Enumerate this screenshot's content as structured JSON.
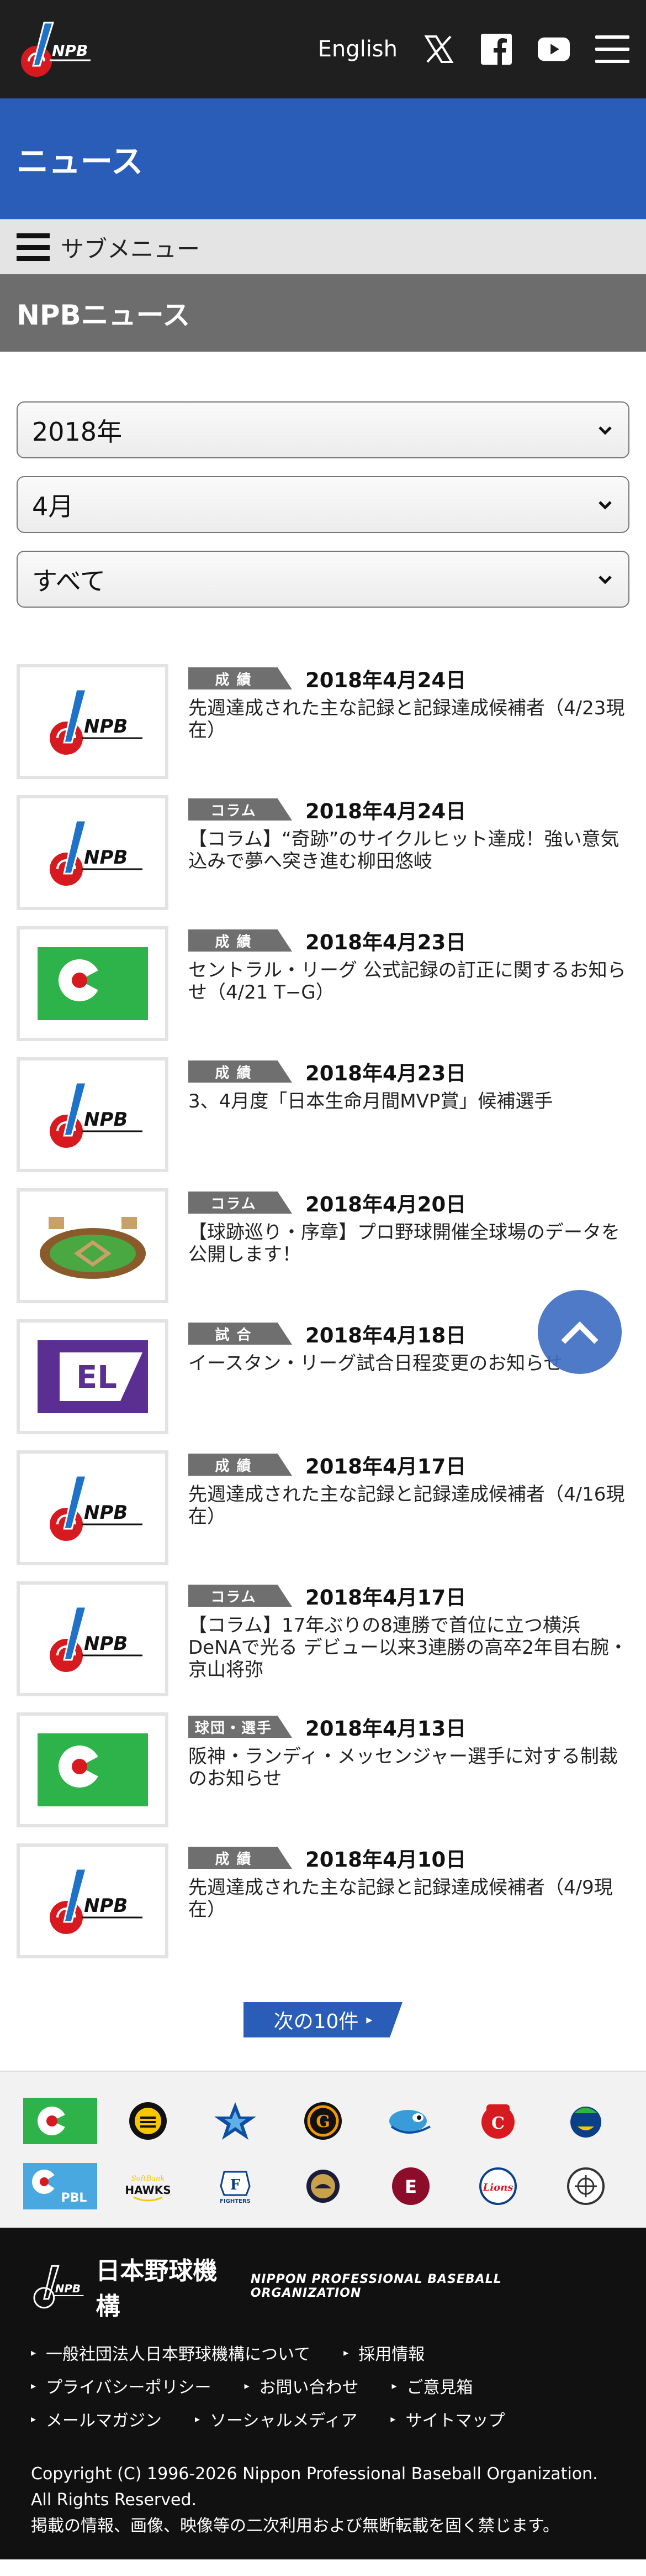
{
  "header": {
    "english_label": "English",
    "icons": [
      "x-icon",
      "facebook-icon",
      "youtube-icon",
      "menu-icon"
    ],
    "logo_text": "NPB"
  },
  "page": {
    "title": "ニュース",
    "submenu_label": "サブメニュー",
    "section_title": "NPBニュース"
  },
  "filters": {
    "year": "2018年",
    "month": "4月",
    "category": "すべて"
  },
  "colors": {
    "header_bg": "#1f1f1f",
    "brand_blue": "#2a5db8",
    "submenu_bg": "#e4e4e4",
    "section_bg": "#6d6d6d",
    "badge_bg": "#6f6f6f",
    "footer_bg": "#111111"
  },
  "news": [
    {
      "badge": "成 績",
      "date": "2018年4月24日",
      "headline": "先週達成された主な記録と記録達成候補者（4/23現在）",
      "thumb": "npb-logo-icon"
    },
    {
      "badge": "コラム",
      "date": "2018年4月24日",
      "headline": "【コラム】“奇跡”のサイクルヒット達成！強い意気込みで夢へ突き進む柳田悠岐",
      "thumb": "npb-logo-icon"
    },
    {
      "badge": "成 績",
      "date": "2018年4月23日",
      "headline": "セントラル・リーグ 公式記録の訂正に関するお知らせ（4/21 T−G）",
      "thumb": "central-league-icon"
    },
    {
      "badge": "成 績",
      "date": "2018年4月23日",
      "headline": "3、4月度「日本生命月間MVP賞」候補選手",
      "thumb": "npb-logo-icon"
    },
    {
      "badge": "コラム",
      "date": "2018年4月20日",
      "headline": "【球跡巡り・序章】プロ野球開催全球場のデータを公開します！",
      "thumb": "stadium-icon"
    },
    {
      "badge": "試 合",
      "date": "2018年4月18日",
      "headline": "イースタン・リーグ試合日程変更のお知らせ",
      "thumb": "eastern-league-icon"
    },
    {
      "badge": "成 績",
      "date": "2018年4月17日",
      "headline": "先週達成された主な記録と記録達成候補者（4/16現在）",
      "thumb": "npb-logo-icon"
    },
    {
      "badge": "コラム",
      "date": "2018年4月17日",
      "headline": "【コラム】17年ぶりの8連勝で首位に立つ横浜DeNAで光る デビュー以来3連勝の高卒2年目右腕・京山将弥",
      "thumb": "npb-logo-icon"
    },
    {
      "badge": "球団・選手",
      "date": "2018年4月13日",
      "headline": "阪神・ランディ・メッセンジャー選手に対する制裁のお知らせ",
      "thumb": "central-league-icon"
    },
    {
      "badge": "成 績",
      "date": "2018年4月10日",
      "headline": "先週達成された主な記録と記録達成候補者（4/9現在）",
      "thumb": "npb-logo-icon"
    }
  ],
  "next_button": "次の10件",
  "teams": {
    "row1": [
      "central-league-icon",
      "tigers-icon",
      "baystars-icon",
      "giants-icon",
      "swallows-icon",
      "carp-icon",
      "dragons-icon"
    ],
    "row2": [
      "pacific-league-icon",
      "hawks-icon",
      "fighters-icon",
      "buffaloes-icon",
      "eagles-icon",
      "lions-icon",
      "marines-icon"
    ]
  },
  "footer": {
    "org_jp": "日本野球機構",
    "org_en": "NIPPON PROFESSIONAL BASEBALL ORGANIZATION",
    "links_row1": [
      "一般社団法人日本野球機構について",
      "採用情報"
    ],
    "links_row2": [
      "プライバシーポリシー",
      "お問い合わせ",
      "ご意見箱"
    ],
    "links_row3": [
      "メールマガジン",
      "ソーシャルメディア",
      "サイトマップ"
    ],
    "copyright_1": "Copyright (C) 1996-2026 Nippon Professional Baseball Organization.",
    "copyright_2": "All Rights Reserved.",
    "copyright_3": "掲載の情報、画像、映像等の二次利用および無断転載を固く禁じます。"
  }
}
